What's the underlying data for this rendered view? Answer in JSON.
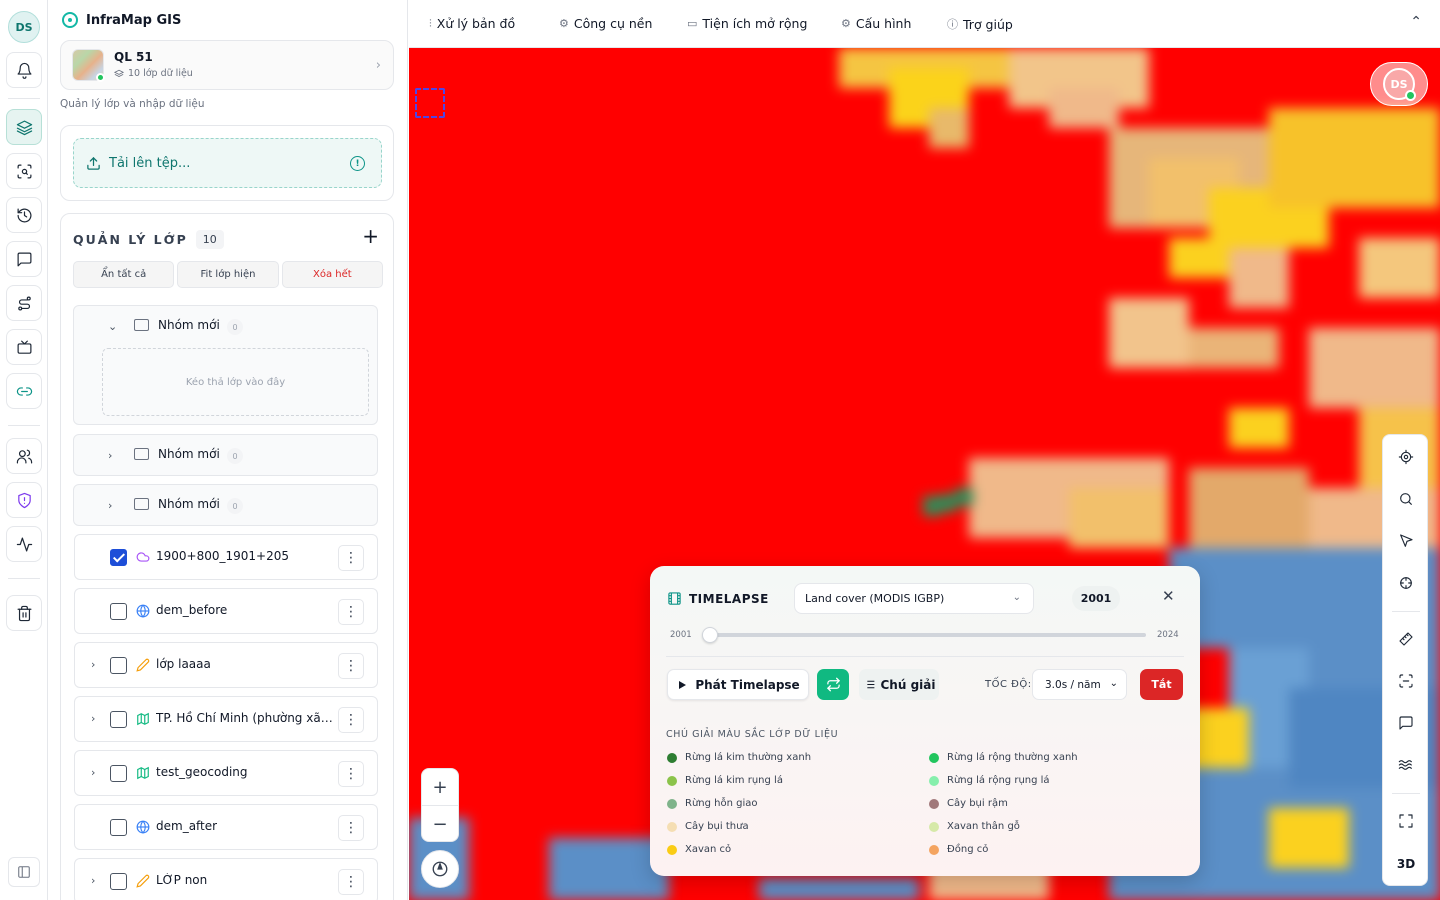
{
  "app": {
    "name": "InfraMap GIS",
    "user_initials": "DS"
  },
  "project": {
    "name": "QL 51",
    "meta": "10 lớp dữ liệu"
  },
  "panel_subtitle": "Quản lý lớp và nhập dữ liệu",
  "upload": {
    "label": "Tải lên tệp..."
  },
  "layers": {
    "title": "QUẢN LÝ LỚP",
    "count": "10",
    "actions": {
      "hide_all": "Ẩn tất cả",
      "fit_visible": "Fit lớp hiện",
      "delete_all": "Xóa hết"
    },
    "groups": [
      {
        "name": "Nhóm mới",
        "count": "0",
        "expanded": true,
        "drop_hint": "Kéo thả lớp vào đây"
      },
      {
        "name": "Nhóm mới",
        "count": "0",
        "expanded": false
      },
      {
        "name": "Nhóm mới",
        "count": "0",
        "expanded": false
      }
    ],
    "items": [
      {
        "name": "1900+800_1901+205",
        "checked": true,
        "icon": "cloud-icon"
      },
      {
        "name": "dem_before",
        "checked": false,
        "icon": "globe-icon"
      },
      {
        "name": "lớp laaaa",
        "checked": false,
        "icon": "pencil-icon"
      },
      {
        "name": "TP. Hồ Chí Minh (phường xã) -...",
        "checked": false,
        "icon": "map-icon"
      },
      {
        "name": "test_geocoding",
        "checked": false,
        "icon": "map-icon"
      },
      {
        "name": "dem_after",
        "checked": false,
        "icon": "globe-icon"
      },
      {
        "name": "LỚP non",
        "checked": false,
        "icon": "pencil-icon"
      }
    ]
  },
  "topmenu": [
    {
      "label": "Xử lý bản đồ",
      "icon": "sliders-icon"
    },
    {
      "label": "Công cụ nền",
      "icon": "gear-icon"
    },
    {
      "label": "Tiện ích mở rộng",
      "icon": "calendar-icon"
    },
    {
      "label": "Cấu hình",
      "icon": "gear-icon"
    },
    {
      "label": "Trợ giúp",
      "icon": "help-icon"
    }
  ],
  "map_tools": {
    "three_d": "3D"
  },
  "timelapse": {
    "title": "TIMELAPSE",
    "dataset": "Land cover (MODIS IGBP)",
    "current_year": "2001",
    "year_min": "2001",
    "year_max": "2024",
    "play_label": "Phát Timelapse",
    "legend_label": "Chú giải",
    "speed_label": "TỐC ĐỘ:",
    "speed_value": "3.0s / năm",
    "off_label": "Tắt",
    "legend_title": "CHÚ GIẢI MÀU SẮC LỚP DỮ LIỆU",
    "legend": [
      {
        "label": "Rừng lá kim thường xanh",
        "color": "#05450a"
      },
      {
        "label": "Rừng lá rộng thường xanh",
        "color": "#086a10"
      },
      {
        "label": "Rừng lá kim rụng lá",
        "color": "#54a708"
      },
      {
        "label": "Rừng lá rộng rụng lá",
        "color": "#78d203"
      },
      {
        "label": "Rừng hỗn giao",
        "color": "#009900"
      },
      {
        "label": "Cây bụi rậm",
        "color": "#c6b044"
      },
      {
        "label": "Cây bụi thưa",
        "color": "#dcd159"
      },
      {
        "label": "Xavan thân gỗ",
        "color": "#dade48"
      },
      {
        "label": "Xavan cỏ",
        "color": "#fbff13"
      },
      {
        "label": "Đồng cỏ",
        "color": "#b6ff05"
      }
    ]
  }
}
